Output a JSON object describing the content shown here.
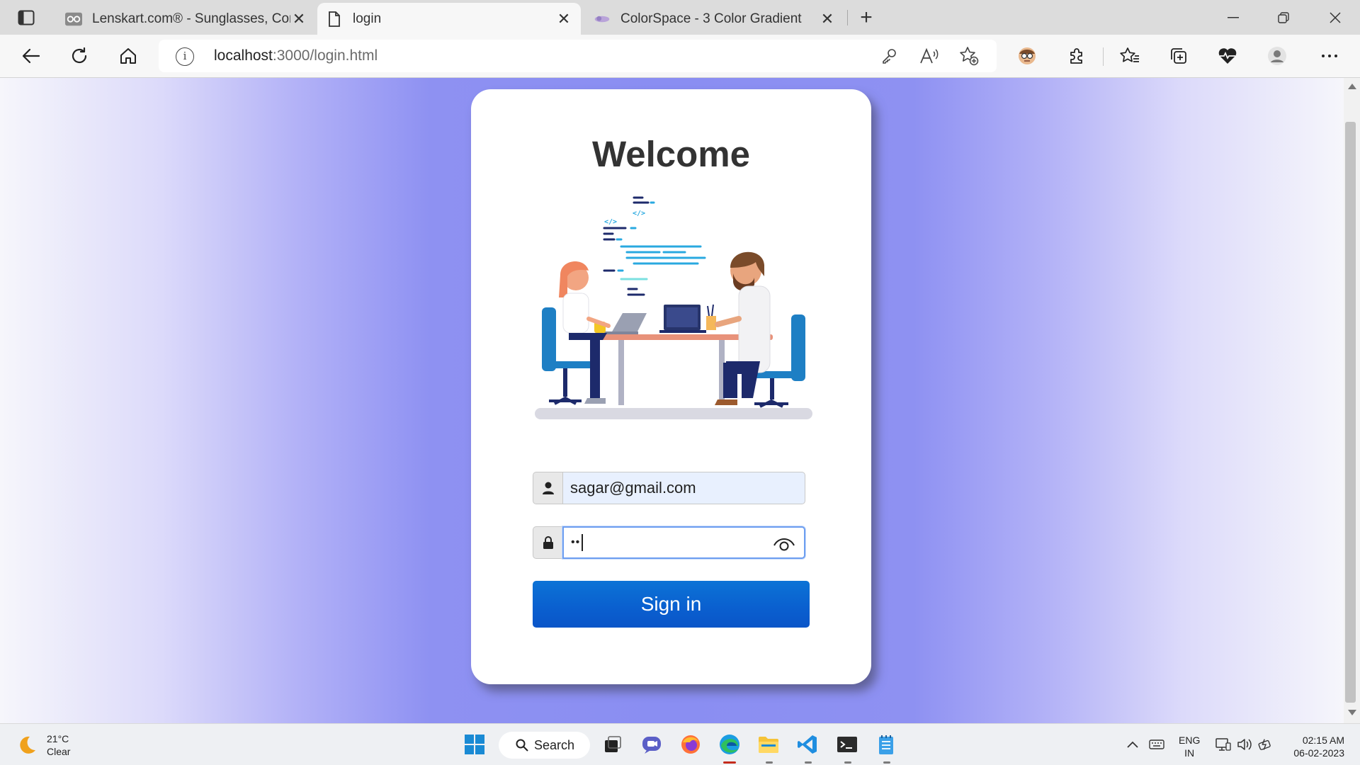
{
  "browser": {
    "tabs": [
      {
        "title": "Lenskart.com® - Sunglasses, Cor",
        "favicon": "lenskart-glasses-icon",
        "active": false
      },
      {
        "title": "login",
        "favicon": "page-icon",
        "active": true
      },
      {
        "title": "ColorSpace - 3 Color Gradient",
        "favicon": "colorspace-icon",
        "active": false
      }
    ],
    "new_tab_label": "+",
    "address": {
      "host": "localhost",
      "path": ":3000/login.html"
    }
  },
  "page": {
    "background_colors": [
      "#f6f6fb",
      "#8a8ef2"
    ],
    "heading": "Welcome",
    "illustration": "two-developers-at-desk-illustration",
    "email": {
      "value": "sagar@gmail.com",
      "icon": "user-icon"
    },
    "password": {
      "masked_value": "••",
      "icon": "lock-icon",
      "toggle_icon": "eye-icon"
    },
    "signin_label": "Sign in",
    "signin_color": "#0a63d2"
  },
  "taskbar": {
    "weather": {
      "temp": "21°C",
      "condition": "Clear"
    },
    "search_label": "Search",
    "lang": {
      "line1": "ENG",
      "line2": "IN"
    },
    "clock": {
      "time": "02:15 AM",
      "date": "06-02-2023"
    }
  }
}
